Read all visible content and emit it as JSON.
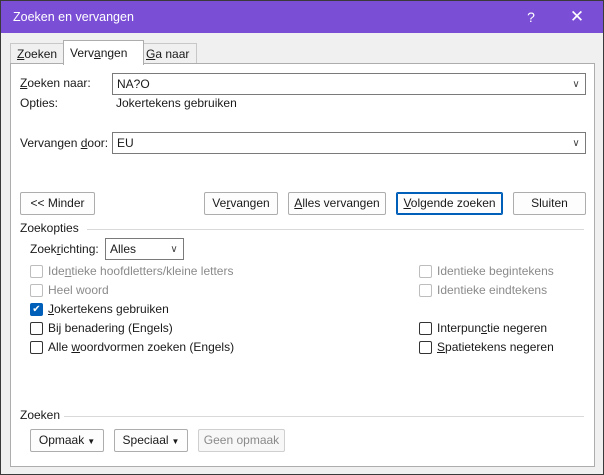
{
  "window": {
    "title": "Zoeken en vervangen",
    "help": "?",
    "close": "✕",
    "accent": "#7a4fd6"
  },
  "tabs": [
    {
      "label_pre": "",
      "label_u": "Z",
      "label_post": "oeken"
    },
    {
      "label_pre": "Verv",
      "label_u": "a",
      "label_post": "ngen"
    },
    {
      "label_pre": "",
      "label_u": "G",
      "label_post": "a naar"
    }
  ],
  "find": {
    "label_u": "Z",
    "label_post": "oeken naar:",
    "value": "NA?O",
    "options_label": "Opties:",
    "options_value": "Jokertekens gebruiken"
  },
  "replace": {
    "label_pre": "Vervangen ",
    "label_u": "d",
    "label_post": "oor:",
    "value": "EU"
  },
  "buttons": {
    "less": "<< Minder",
    "replace_pre": "Ve",
    "replace_u": "r",
    "replace_post": "vangen",
    "replace_all_pre": "",
    "replace_all_u": "A",
    "replace_all_post": "lles vervangen",
    "find_next_pre": "",
    "find_next_u": "V",
    "find_next_post": "olgende zoeken",
    "close": "Sluiten"
  },
  "search_options": {
    "header": "Zoekopties",
    "direction_label_pre": "Zoek",
    "direction_label_u": "r",
    "direction_label_post": "ichting:",
    "direction_value": "Alles"
  },
  "checkboxes_left": [
    {
      "pre": "Ide",
      "u": "n",
      "post": "tieke hoofdletters/kleine letters",
      "checked": false,
      "disabled": true
    },
    {
      "pre": "Heel woord",
      "u": "",
      "post": "",
      "checked": false,
      "disabled": true
    },
    {
      "pre": "",
      "u": "J",
      "post": "okertekens gebruiken",
      "checked": true,
      "disabled": false
    },
    {
      "pre": "Bij benadering (Engels)",
      "u": "",
      "post": "",
      "checked": false,
      "disabled": false
    },
    {
      "pre": "Alle ",
      "u": "w",
      "post": "oordvormen zoeken (Engels)",
      "checked": false,
      "disabled": false
    }
  ],
  "checkboxes_right": [
    {
      "pre": "Identieke begintekens",
      "u": "",
      "post": "",
      "checked": false,
      "disabled": true
    },
    {
      "pre": "Identieke eindtekens",
      "u": "",
      "post": "",
      "checked": false,
      "disabled": true
    },
    {
      "pre": "Interpun",
      "u": "c",
      "post": "tie negeren",
      "checked": false,
      "disabled": false
    },
    {
      "pre": "",
      "u": "S",
      "post": "patietekens negeren",
      "checked": false,
      "disabled": false
    }
  ],
  "bottom": {
    "header": "Zoeken",
    "format": "Opmaak",
    "format_u": "a",
    "special": "Speciaal",
    "no_format": "Geen opmaak"
  }
}
